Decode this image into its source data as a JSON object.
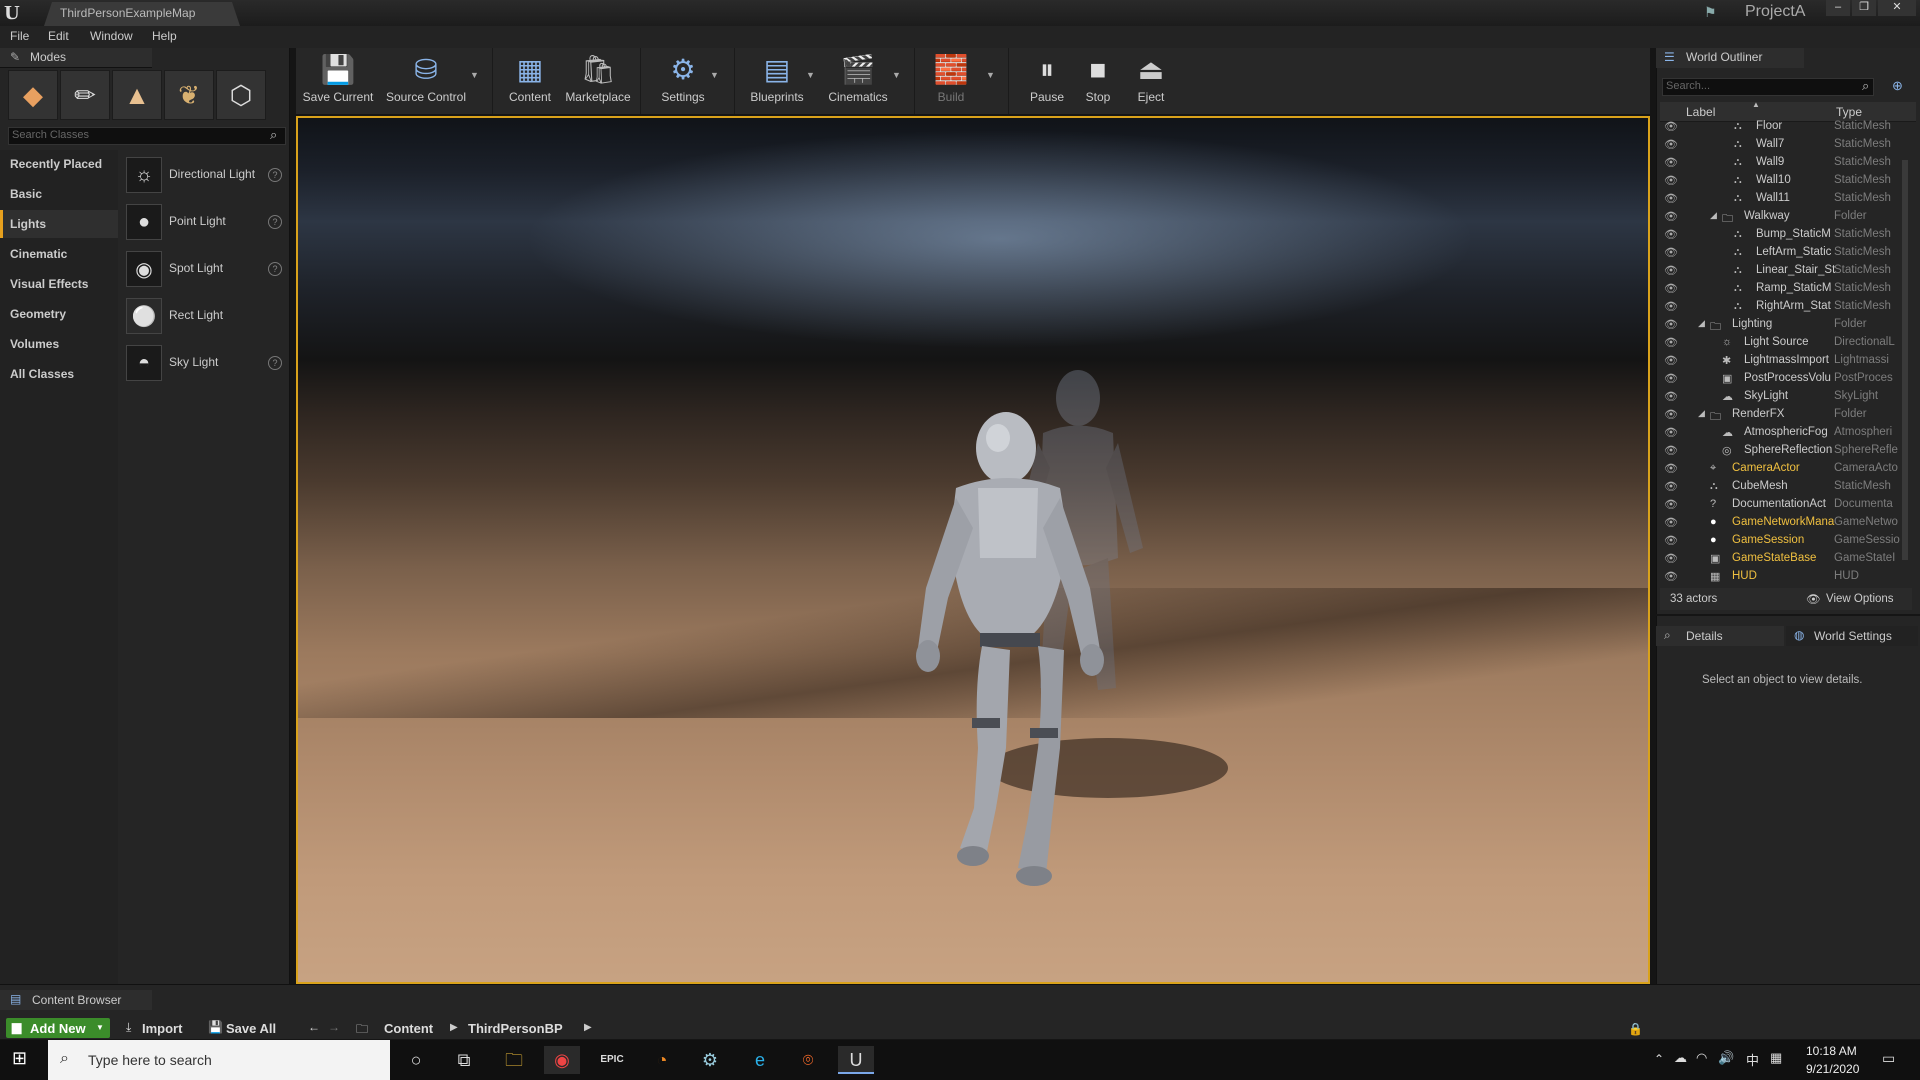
{
  "titlebar": {
    "tab": "ThirdPersonExampleMap",
    "project": "ProjectA"
  },
  "menu": [
    "File",
    "Edit",
    "Window",
    "Help"
  ],
  "modes": {
    "title": "Modes",
    "search_placeholder": "Search Classes",
    "categories": [
      "Recently Placed",
      "Basic",
      "Lights",
      "Cinematic",
      "Visual Effects",
      "Geometry",
      "Volumes",
      "All Classes"
    ],
    "selected_category": "Lights",
    "items": [
      "Directional Light",
      "Point Light",
      "Spot Light",
      "Rect Light",
      "Sky Light"
    ]
  },
  "toolbar": [
    "Save Current",
    "Source Control",
    "Content",
    "Marketplace",
    "Settings",
    "Blueprints",
    "Cinematics",
    "Build",
    "Pause",
    "Stop",
    "Eject"
  ],
  "outliner": {
    "title": "World Outliner",
    "search_placeholder": "Search...",
    "col_label": "Label",
    "col_type": "Type",
    "rows": [
      {
        "label": "Floor",
        "type": "StaticMesh"
      },
      {
        "label": "Wall7",
        "type": "StaticMesh"
      },
      {
        "label": "Wall9",
        "type": "StaticMesh"
      },
      {
        "label": "Wall10",
        "type": "StaticMesh"
      },
      {
        "label": "Wall11",
        "type": "StaticMesh"
      },
      {
        "label": "Walkway",
        "type": "Folder"
      },
      {
        "label": "Bump_StaticM",
        "type": "StaticMesh"
      },
      {
        "label": "LeftArm_Static",
        "type": "StaticMesh"
      },
      {
        "label": "Linear_Stair_St",
        "type": "StaticMesh"
      },
      {
        "label": "Ramp_StaticM",
        "type": "StaticMesh"
      },
      {
        "label": "RightArm_Stat",
        "type": "StaticMesh"
      },
      {
        "label": "Lighting",
        "type": "Folder"
      },
      {
        "label": "Light Source",
        "type": "DirectionalL"
      },
      {
        "label": "LightmassImport",
        "type": "Lightmassi"
      },
      {
        "label": "PostProcessVolu",
        "type": "PostProces"
      },
      {
        "label": "SkyLight",
        "type": "SkyLight"
      },
      {
        "label": "RenderFX",
        "type": "Folder"
      },
      {
        "label": "AtmosphericFog",
        "type": "Atmospheri"
      },
      {
        "label": "SphereReflection",
        "type": "SphereRefle"
      },
      {
        "label": "CameraActor",
        "type": "CameraActo"
      },
      {
        "label": "CubeMesh",
        "type": "StaticMesh"
      },
      {
        "label": "DocumentationAct",
        "type": "Documenta"
      },
      {
        "label": "GameNetworkMana",
        "type": "GameNetwo"
      },
      {
        "label": "GameSession",
        "type": "GameSessio"
      },
      {
        "label": "GameStateBase",
        "type": "GameStateI"
      },
      {
        "label": "HUD",
        "type": "HUD"
      }
    ],
    "actor_count": "33 actors",
    "view_options": "View Options"
  },
  "details": {
    "tab": "Details",
    "world_tab": "World Settings",
    "empty_message": "Select an object to view details."
  },
  "content_browser": {
    "tab": "Content Browser",
    "add_new": "Add New",
    "import": "Import",
    "save_all": "Save All",
    "path": [
      "Content",
      "ThirdPersonBP"
    ]
  },
  "taskbar": {
    "search_placeholder": "Type here to search",
    "time": "10:18 AM",
    "date": "9/21/2020",
    "ime": "中"
  }
}
